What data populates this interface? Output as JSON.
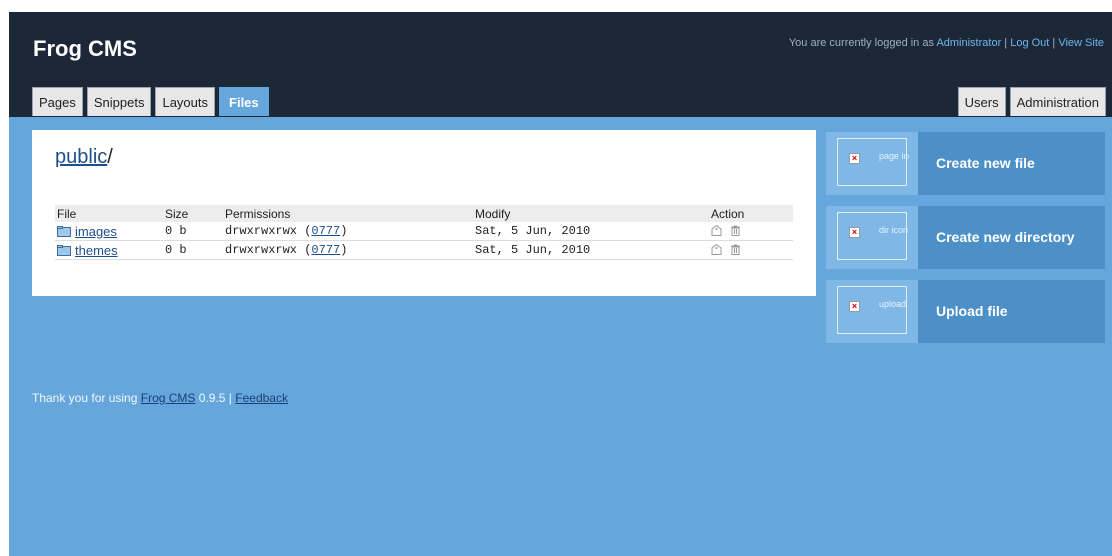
{
  "header": {
    "logo": "Frog CMS",
    "login_prefix": "You are currently logged in as",
    "user_link": "Administrator",
    "logout_link": "Log Out",
    "view_site_link": "View Site",
    "separator": "|"
  },
  "tabs": {
    "left": [
      {
        "label": "Pages"
      },
      {
        "label": "Snippets"
      },
      {
        "label": "Layouts"
      },
      {
        "label": "Files",
        "active": true
      }
    ],
    "right": [
      {
        "label": "Users"
      },
      {
        "label": "Administration"
      }
    ]
  },
  "main": {
    "path_link": "public",
    "path_suffix": "/",
    "columns": [
      "File",
      "Size",
      "Permissions",
      "Modify",
      "Action"
    ],
    "rows": [
      {
        "name": "images",
        "size": "0 b",
        "permissions": "drwxrwxrwx",
        "octal": "0777",
        "modified": "Sat, 5 Jun, 2010"
      },
      {
        "name": "themes",
        "size": "0 b",
        "permissions": "drwxrwxrwx",
        "octal": "0777",
        "modified": "Sat, 5 Jun, 2010"
      }
    ]
  },
  "sidebar": {
    "actions": [
      {
        "label": "Create new file",
        "icon_alt": "page icon",
        "icon": "page-icon"
      },
      {
        "label": "Create new directory",
        "icon_alt": "dir icon",
        "icon": "dir-icon"
      },
      {
        "label": "Upload file",
        "icon_alt": "upload icon",
        "icon": "upload-icon"
      }
    ]
  },
  "footer": {
    "thanks": "Thank you for using",
    "product_link": "Frog CMS",
    "version": "0.9.5 |",
    "feedback_link": "Feedback"
  },
  "colors": {
    "header_bg": "#1c2738",
    "page_bg": "#65a7dc",
    "sidebar_action_bg": "#4d8fc7",
    "link": "#1f4e8c"
  }
}
